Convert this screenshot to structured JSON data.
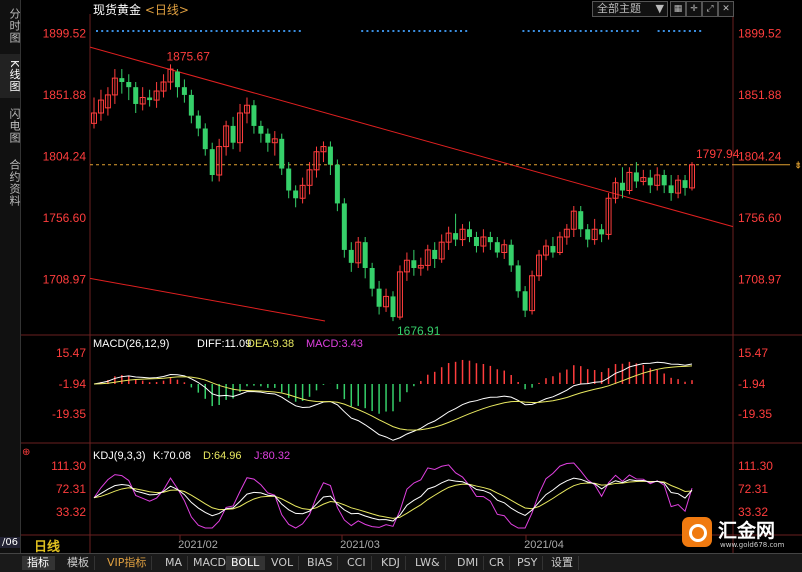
{
  "sidebar": {
    "tabs": [
      {
        "label": "分时图"
      },
      {
        "label": "K线图"
      },
      {
        "label": "闪电图"
      },
      {
        "label": "合约资料"
      }
    ]
  },
  "header": {
    "title": "现货黄金",
    "period": "<日线>",
    "theme_button": "全部主题"
  },
  "main_axis": {
    "ticks": [
      "1899.52",
      "1851.88",
      "1804.24",
      "1756.60",
      "1708.97"
    ]
  },
  "annotations": {
    "high": "1875.67",
    "low": "1676.91",
    "last": "1797.94"
  },
  "macd_panel": {
    "name": "MACD(26,12,9)",
    "diff": "DIFF:11.09",
    "dea": "DEA:9.38",
    "macd": "MACD:3.43",
    "ticks": [
      "15.47",
      "-1.94",
      "-19.35"
    ]
  },
  "kdj_panel": {
    "name": "KDJ(9,3,3)",
    "k": "K:70.08",
    "d": "D:64.96",
    "j": "J:80.32",
    "ticks": [
      "111.30",
      "72.31",
      "33.32"
    ]
  },
  "x_axis": {
    "labels": [
      "2021/02",
      "2021/03",
      "2021/04"
    ]
  },
  "bottom": {
    "date_frag": "/06",
    "period": "日线",
    "tabs": [
      "指标",
      "模板",
      "VIP指标",
      "MA",
      "MACD",
      "BOLL",
      "VOL",
      "BIAS",
      "CCI",
      "KDJ",
      "LW&",
      "DMI",
      "CR",
      "PSY",
      "设置"
    ]
  },
  "logo": {
    "name": "汇金网",
    "url": "www.gold678.com"
  },
  "colors": {
    "up": "#ff3d3d",
    "down": "#36d06a",
    "diff": "#ffffff",
    "dea": "#e8e860",
    "j": "#e040e0",
    "trend": "#e02020"
  },
  "chart_data": {
    "type": "candlestick",
    "ylim": [
      1670,
      1910
    ],
    "candles": [
      [
        1830,
        1838,
        1850,
        1826
      ],
      [
        1838,
        1848,
        1856,
        1832
      ],
      [
        1842,
        1852,
        1858,
        1836
      ],
      [
        1852,
        1865,
        1872,
        1845
      ],
      [
        1865,
        1862,
        1872,
        1853
      ],
      [
        1862,
        1858,
        1868,
        1848
      ],
      [
        1858,
        1845,
        1862,
        1838
      ],
      [
        1845,
        1850,
        1858,
        1840
      ],
      [
        1850,
        1848,
        1856,
        1843
      ],
      [
        1848,
        1855,
        1862,
        1842
      ],
      [
        1855,
        1862,
        1868,
        1850
      ],
      [
        1862,
        1872,
        1875.67,
        1856
      ],
      [
        1870,
        1858,
        1872,
        1850
      ],
      [
        1858,
        1852,
        1864,
        1846
      ],
      [
        1852,
        1836,
        1856,
        1830
      ],
      [
        1836,
        1826,
        1840,
        1820
      ],
      [
        1826,
        1810,
        1830,
        1805
      ],
      [
        1810,
        1790,
        1815,
        1785
      ],
      [
        1790,
        1812,
        1818,
        1785
      ],
      [
        1812,
        1828,
        1832,
        1805
      ],
      [
        1828,
        1815,
        1835,
        1810
      ],
      [
        1815,
        1838,
        1845,
        1808
      ],
      [
        1838,
        1844,
        1850,
        1830
      ],
      [
        1844,
        1828,
        1848,
        1822
      ],
      [
        1828,
        1822,
        1832,
        1815
      ],
      [
        1822,
        1815,
        1826,
        1808
      ],
      [
        1815,
        1818,
        1824,
        1805
      ],
      [
        1818,
        1795,
        1822,
        1790
      ],
      [
        1795,
        1778,
        1800,
        1772
      ],
      [
        1778,
        1772,
        1782,
        1765
      ],
      [
        1772,
        1782,
        1788,
        1768
      ],
      [
        1782,
        1794,
        1800,
        1775
      ],
      [
        1794,
        1808,
        1812,
        1788
      ],
      [
        1808,
        1812,
        1816,
        1800
      ],
      [
        1812,
        1798,
        1816,
        1790
      ],
      [
        1798,
        1768,
        1802,
        1762
      ],
      [
        1768,
        1732,
        1772,
        1726
      ],
      [
        1732,
        1722,
        1738,
        1715
      ],
      [
        1722,
        1738,
        1742,
        1718
      ],
      [
        1738,
        1718,
        1742,
        1710
      ],
      [
        1718,
        1702,
        1722,
        1696
      ],
      [
        1702,
        1688,
        1708,
        1682
      ],
      [
        1688,
        1696,
        1702,
        1684
      ],
      [
        1696,
        1680,
        1700,
        1676.91
      ],
      [
        1680,
        1715,
        1720,
        1678
      ],
      [
        1715,
        1724,
        1730,
        1708
      ],
      [
        1724,
        1718,
        1732,
        1712
      ],
      [
        1718,
        1720,
        1726,
        1712
      ],
      [
        1720,
        1732,
        1736,
        1716
      ],
      [
        1732,
        1725,
        1738,
        1718
      ],
      [
        1725,
        1738,
        1744,
        1722
      ],
      [
        1738,
        1745,
        1750,
        1732
      ],
      [
        1745,
        1740,
        1760,
        1735
      ],
      [
        1740,
        1748,
        1752,
        1735
      ],
      [
        1748,
        1742,
        1754,
        1738
      ],
      [
        1742,
        1735,
        1746,
        1730
      ],
      [
        1735,
        1742,
        1748,
        1730
      ],
      [
        1742,
        1738,
        1746,
        1732
      ],
      [
        1738,
        1730,
        1742,
        1726
      ],
      [
        1730,
        1736,
        1740,
        1725
      ],
      [
        1736,
        1720,
        1740,
        1715
      ],
      [
        1720,
        1700,
        1724,
        1695
      ],
      [
        1700,
        1685,
        1704,
        1680
      ],
      [
        1685,
        1712,
        1716,
        1682
      ],
      [
        1712,
        1728,
        1732,
        1708
      ],
      [
        1728,
        1735,
        1740,
        1724
      ],
      [
        1735,
        1730,
        1742,
        1726
      ],
      [
        1730,
        1742,
        1746,
        1728
      ],
      [
        1742,
        1748,
        1752,
        1736
      ],
      [
        1748,
        1762,
        1766,
        1742
      ],
      [
        1762,
        1748,
        1766,
        1742
      ],
      [
        1748,
        1740,
        1752,
        1734
      ],
      [
        1740,
        1748,
        1756,
        1736
      ],
      [
        1748,
        1744,
        1752,
        1738
      ],
      [
        1744,
        1772,
        1776,
        1740
      ],
      [
        1772,
        1784,
        1788,
        1768
      ],
      [
        1784,
        1778,
        1796,
        1772
      ],
      [
        1778,
        1792,
        1796,
        1775
      ],
      [
        1792,
        1785,
        1800,
        1780
      ],
      [
        1785,
        1788,
        1794,
        1782
      ],
      [
        1788,
        1782,
        1794,
        1776
      ],
      [
        1782,
        1790,
        1796,
        1778
      ],
      [
        1790,
        1782,
        1794,
        1776
      ],
      [
        1782,
        1776,
        1790,
        1770
      ],
      [
        1776,
        1786,
        1790,
        1772
      ],
      [
        1786,
        1780,
        1790,
        1774
      ],
      [
        1780,
        1797.94,
        1800,
        1778
      ]
    ],
    "dashed_level": 1797.94
  }
}
